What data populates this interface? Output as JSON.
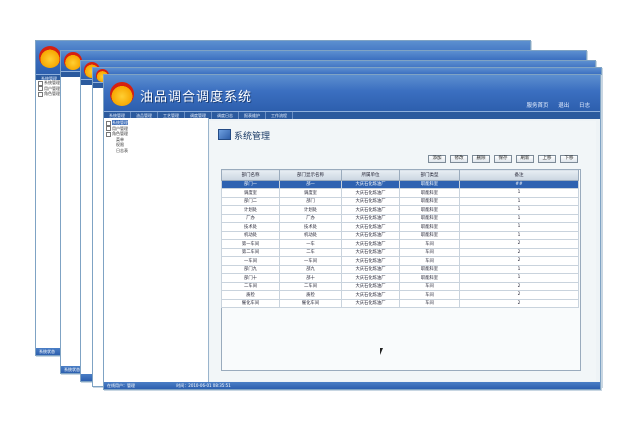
{
  "app": {
    "title": "油品调合调度系统",
    "header_links": [
      "服务首页",
      "退出",
      "日志"
    ],
    "menu": [
      "系统管理",
      "油品管理",
      "工艺管理",
      "调度管理",
      "调度日志",
      "报表维护",
      "工作流程"
    ]
  },
  "sidebar": {
    "header": "系统管理",
    "tree": [
      "系统管理",
      "用户管理",
      "角色管理",
      "菜单",
      "权限",
      "日志表"
    ]
  },
  "back_windows": {
    "status_label": "系统状态"
  },
  "page": {
    "title": "系统管理",
    "toolbar": [
      "添加",
      "修改",
      "删除",
      "保存",
      "刷新",
      "上移",
      "下移"
    ],
    "table": {
      "columns": [
        "部门名称",
        "部门显示名称",
        "所属单位",
        "部门类型",
        "备注"
      ],
      "rows": [
        [
          "部门一",
          "部一",
          "大庆石化炼油厂",
          "职能科室",
          "##"
        ],
        [
          "调度室",
          "调度室",
          "大庆石化炼油厂",
          "职能科室",
          "1"
        ],
        [
          "部门二",
          "部门",
          "大庆石化炼油厂",
          "职能科室",
          "1"
        ],
        [
          "计划处",
          "计划处",
          "大庆石化炼油厂",
          "职能科室",
          "1"
        ],
        [
          "厂办",
          "厂办",
          "大庆石化炼油厂",
          "职能科室",
          "1"
        ],
        [
          "技术处",
          "技术处",
          "大庆石化炼油厂",
          "职能科室",
          "1"
        ],
        [
          "机动处",
          "机动处",
          "大庆石化炼油厂",
          "职能科室",
          "1"
        ],
        [
          "第一车间",
          "一车",
          "大庆石化炼油厂",
          "车间",
          "2"
        ],
        [
          "第二车间",
          "二车",
          "大庆石化炼油厂",
          "车间",
          "2"
        ],
        [
          "一车间",
          "一车间",
          "大庆石化炼油厂",
          "车间",
          "2"
        ],
        [
          "部门九",
          "部九",
          "大庆石化炼油厂",
          "职能科室",
          "1"
        ],
        [
          "部门十",
          "部十",
          "大庆石化炼油厂",
          "职能科室",
          "1"
        ],
        [
          "二车间",
          "二车间",
          "大庆石化炼油厂",
          "车间",
          "2"
        ],
        [
          "质检",
          "质检",
          "大庆石化炼油厂",
          "车间",
          "2"
        ],
        [
          "催化车间",
          "催化车间",
          "大庆石化炼油厂",
          "车间",
          "2"
        ]
      ]
    },
    "status": {
      "label": "在线用户：",
      "user": "管理",
      "time_label": "时间：",
      "time": "2010-06-01 08:35:51"
    }
  },
  "colors": {
    "banner": "#3b6fc0",
    "selected_row": "#2e62b1",
    "accent_logo": "#d62010"
  }
}
